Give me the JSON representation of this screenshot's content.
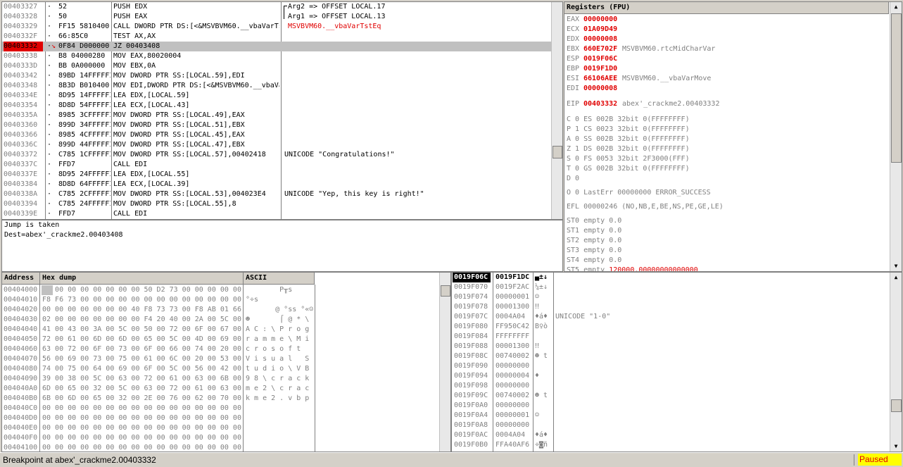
{
  "disasm": {
    "rows": [
      {
        "addr": "00403327",
        "mark": "·",
        "hex": "52",
        "asm": "PUSH EDX",
        "comment": "Arg2 => OFFSET LOCAL.17"
      },
      {
        "addr": "00403328",
        "mark": "·",
        "hex": "50",
        "asm": "PUSH EAX",
        "comment": "Arg1 => OFFSET LOCAL.13"
      },
      {
        "addr": "00403329",
        "mark": "·",
        "hex": "FF15 5810400(",
        "asm": "CALL DWORD PTR DS:[<&MSVBVM60.__vbaVarTs",
        "comment": "MSVBVM60.__vbaVarTstEq"
      },
      {
        "addr": "0040332F",
        "mark": "·",
        "hex": "66:85C0",
        "asm": "TEST AX,AX",
        "comment": ""
      },
      {
        "addr": "00403332",
        "mark": "·",
        "hex": "0F84 D000000(",
        "asm": "JZ 00403408",
        "comment": ""
      },
      {
        "addr": "00403338",
        "mark": "·",
        "hex": "B8 04000280",
        "asm": "MOV EAX,80020004",
        "comment": ""
      },
      {
        "addr": "0040333D",
        "mark": "·",
        "hex": "BB 0A000000",
        "asm": "MOV EBX,0A",
        "comment": ""
      },
      {
        "addr": "00403342",
        "mark": "·",
        "hex": "89BD 14FFFFFI",
        "asm": "MOV DWORD PTR SS:[LOCAL.59],EDI",
        "comment": ""
      },
      {
        "addr": "00403348",
        "mark": "·",
        "hex": "8B3D B010400(",
        "asm": "MOV EDI,DWORD PTR DS:[<&MSVBVM60.__vbaVa",
        "comment": ""
      },
      {
        "addr": "0040334E",
        "mark": "·",
        "hex": "8D95 14FFFFFI",
        "asm": "LEA EDX,[LOCAL.59]",
        "comment": ""
      },
      {
        "addr": "00403354",
        "mark": "·",
        "hex": "8D8D 54FFFFFI",
        "asm": "LEA ECX,[LOCAL.43]",
        "comment": ""
      },
      {
        "addr": "0040335A",
        "mark": "·",
        "hex": "8985 3CFFFFFI",
        "asm": "MOV DWORD PTR SS:[LOCAL.49],EAX",
        "comment": ""
      },
      {
        "addr": "00403360",
        "mark": "·",
        "hex": "899D 34FFFFFI",
        "asm": "MOV DWORD PTR SS:[LOCAL.51],EBX",
        "comment": ""
      },
      {
        "addr": "00403366",
        "mark": "·",
        "hex": "8985 4CFFFFFI",
        "asm": "MOV DWORD PTR SS:[LOCAL.45],EAX",
        "comment": ""
      },
      {
        "addr": "0040336C",
        "mark": "·",
        "hex": "899D 44FFFFFI",
        "asm": "MOV DWORD PTR SS:[LOCAL.47],EBX",
        "comment": ""
      },
      {
        "addr": "00403372",
        "mark": "·",
        "hex": "C785 1CFFFFFI",
        "asm": "MOV DWORD PTR SS:[LOCAL.57],00402418",
        "comment": "UNICODE \"Congratulations!\""
      },
      {
        "addr": "0040337C",
        "mark": "·",
        "hex": "FFD7",
        "asm": "CALL EDI",
        "comment": ""
      },
      {
        "addr": "0040337E",
        "mark": "·",
        "hex": "8D95 24FFFFFI",
        "asm": "LEA EDX,[LOCAL.55]",
        "comment": ""
      },
      {
        "addr": "00403384",
        "mark": "·",
        "hex": "8D8D 64FFFFFI",
        "asm": "LEA ECX,[LOCAL.39]",
        "comment": ""
      },
      {
        "addr": "0040338A",
        "mark": "·",
        "hex": "C785 2CFFFFFI",
        "asm": "MOV DWORD PTR SS:[LOCAL.53],004023E4",
        "comment": "UNICODE \"Yep, this key is right!\""
      },
      {
        "addr": "00403394",
        "mark": "·",
        "hex": "C785 24FFFFFI",
        "asm": "MOV DWORD PTR SS:[LOCAL.55],8",
        "comment": ""
      },
      {
        "addr": "0040339E",
        "mark": "·",
        "hex": "FFD7",
        "asm": "CALL EDI",
        "comment": ""
      }
    ]
  },
  "info": {
    "line1": "Jump is taken",
    "line2": "Dest=abex'_crackme2.00403408"
  },
  "registers": {
    "title": "Registers (FPU)",
    "gp": [
      {
        "name": "EAX",
        "value": "00000000",
        "extra": ""
      },
      {
        "name": "ECX",
        "value": "01A09D49",
        "extra": ""
      },
      {
        "name": "EDX",
        "value": "00000008",
        "extra": ""
      },
      {
        "name": "EBX",
        "value": "660E702F",
        "extra": "MSVBVM60.rtcMidCharVar"
      },
      {
        "name": "ESP",
        "value": "0019F06C",
        "extra": ""
      },
      {
        "name": "EBP",
        "value": "0019F1D0",
        "extra": ""
      },
      {
        "name": "ESI",
        "value": "66106AEE",
        "extra": "MSVBVM60.__vbaVarMove"
      },
      {
        "name": "EDI",
        "value": "00000008",
        "extra": ""
      }
    ],
    "eip": {
      "name": "EIP",
      "value": "00403332",
      "extra": "abex'_crackme2.00403332"
    },
    "flags": [
      "C 0   ES 002B 32bit 0(FFFFFFFF)",
      "P 1   CS 0023 32bit 0(FFFFFFFF)",
      "A 0   SS 002B 32bit 0(FFFFFFFF)",
      "Z 1   DS 002B 32bit 0(FFFFFFFF)",
      "S 0   FS 0053 32bit 2F3000(FFF)",
      "T 0   GS 002B 32bit 0(FFFFFFFF)",
      "D 0",
      "O 0   LastErr 00000000 ERROR_SUCCESS"
    ],
    "efl": "EFL 00000246 (NO,NB,E,BE,NS,PE,GE,LE)",
    "fpu": [
      {
        "text": "ST0 empty 0.0",
        "red": ""
      },
      {
        "text": "ST1 empty 0.0",
        "red": ""
      },
      {
        "text": "ST2 empty 0.0",
        "red": ""
      },
      {
        "text": "ST3 empty 0.0",
        "red": ""
      },
      {
        "text": "ST4 empty 0.0",
        "red": ""
      },
      {
        "text": "ST5 empty ",
        "red": "120000.00000000000000"
      }
    ]
  },
  "dump": {
    "headers": {
      "address": "Address",
      "hex": "Hex dump",
      "ascii": "ASCII"
    },
    "rows": [
      {
        "addr": "00404000",
        "hex": "00 00 00 00 00 00 00 00 50 D2 73 00 00 00 00 00",
        "ascii": "        P╥s"
      },
      {
        "addr": "00404010",
        "hex": "F8 F6 73 00 00 00 00 00 00 00 00 00 00 00 00 00",
        "ascii": "°÷s"
      },
      {
        "addr": "00404020",
        "hex": "00 00 00 00 00 00 00 40 F8 73 73 00 F8 AB 01 66",
        "ascii": "       @ °ss °«☺f"
      },
      {
        "addr": "00404030",
        "hex": "02 00 00 00 00 00 00 00 F4 20 40 00 2A 00 5C 00",
        "ascii": "☻       ⌠ @ * \\"
      },
      {
        "addr": "00404040",
        "hex": "41 00 43 00 3A 00 5C 00 50 00 72 00 6F 00 67 00",
        "ascii": "A C : \\ P r o g"
      },
      {
        "addr": "00404050",
        "hex": "72 00 61 00 6D 00 6D 00 65 00 5C 00 4D 00 69 00",
        "ascii": "r a m m e \\ M i"
      },
      {
        "addr": "00404060",
        "hex": "63 00 72 00 6F 00 73 00 6F 00 66 00 74 00 20 00",
        "ascii": "c r o s o f t"
      },
      {
        "addr": "00404070",
        "hex": "56 00 69 00 73 00 75 00 61 00 6C 00 20 00 53 00",
        "ascii": "V i s u a l   S"
      },
      {
        "addr": "00404080",
        "hex": "74 00 75 00 64 00 69 00 6F 00 5C 00 56 00 42 00",
        "ascii": "t u d i o \\ V B"
      },
      {
        "addr": "00404090",
        "hex": "39 00 38 00 5C 00 63 00 72 00 61 00 63 00 6B 00",
        "ascii": "9 8 \\ c r a c k"
      },
      {
        "addr": "004040A0",
        "hex": "6D 00 65 00 32 00 5C 00 63 00 72 00 61 00 63 00",
        "ascii": "m e 2 \\ c r a c"
      },
      {
        "addr": "004040B0",
        "hex": "6B 00 6D 00 65 00 32 00 2E 00 76 00 62 00 70 00",
        "ascii": "k m e 2 . v b p"
      },
      {
        "addr": "004040C0",
        "hex": "00 00 00 00 00 00 00 00 00 00 00 00 00 00 00 00",
        "ascii": ""
      },
      {
        "addr": "004040D0",
        "hex": "00 00 00 00 00 00 00 00 00 00 00 00 00 00 00 00",
        "ascii": ""
      },
      {
        "addr": "004040E0",
        "hex": "00 00 00 00 00 00 00 00 00 00 00 00 00 00 00 00",
        "ascii": ""
      },
      {
        "addr": "004040F0",
        "hex": "00 00 00 00 00 00 00 00 00 00 00 00 00 00 00 00",
        "ascii": ""
      },
      {
        "addr": "00404100",
        "hex": "00 00 00 00 00 00 00 00 00 00 00 00 00 00 00 00",
        "ascii": ""
      }
    ]
  },
  "stack": {
    "headers": {
      "addr": "0019F06C",
      "value": "0019F1DC",
      "ascii": "▄±↓"
    },
    "rows": [
      {
        "addr": "0019F070",
        "value": "0019F2AC",
        "ascii": "¼±↓",
        "comment": ""
      },
      {
        "addr": "0019F074",
        "value": "00000001",
        "ascii": "☺",
        "comment": ""
      },
      {
        "addr": "0019F078",
        "value": "00001300",
        "ascii": "‼",
        "comment": ""
      },
      {
        "addr": "0019F07C",
        "value": "0004A04",
        "ascii": "♦á♦",
        "comment": "UNICODE \"1-0\""
      },
      {
        "addr": "0019F080",
        "value": "FF950C42",
        "ascii": "B♀ò",
        "comment": ""
      },
      {
        "addr": "0019F084",
        "value": "FFFFFFFF",
        "ascii": "",
        "comment": ""
      },
      {
        "addr": "0019F088",
        "value": "00001300",
        "ascii": "‼",
        "comment": ""
      },
      {
        "addr": "0019F08C",
        "value": "00740002",
        "ascii": "☻ t",
        "comment": ""
      },
      {
        "addr": "0019F090",
        "value": "00000000",
        "ascii": "",
        "comment": ""
      },
      {
        "addr": "0019F094",
        "value": "00000004",
        "ascii": "♦",
        "comment": ""
      },
      {
        "addr": "0019F098",
        "value": "00000000",
        "ascii": "",
        "comment": ""
      },
      {
        "addr": "0019F09C",
        "value": "00740002",
        "ascii": "☻ t",
        "comment": ""
      },
      {
        "addr": "0019F0A0",
        "value": "00000000",
        "ascii": "",
        "comment": ""
      },
      {
        "addr": "0019F0A4",
        "value": "00000001",
        "ascii": "☺",
        "comment": ""
      },
      {
        "addr": "0019F0A8",
        "value": "00000000",
        "ascii": "",
        "comment": ""
      },
      {
        "addr": "0019F0AC",
        "value": "0004A04",
        "ascii": "♦á♦",
        "comment": ""
      },
      {
        "addr": "0019F0B0",
        "value": "FFA40AF6",
        "ascii": "÷◙ñ",
        "comment": ""
      }
    ]
  },
  "status": {
    "text": "Breakpoint at abex'_crackme2.00403332",
    "state": "Paused"
  },
  "colors": {
    "accent_red": "#e00000",
    "paused_bg": "#ffff00"
  }
}
